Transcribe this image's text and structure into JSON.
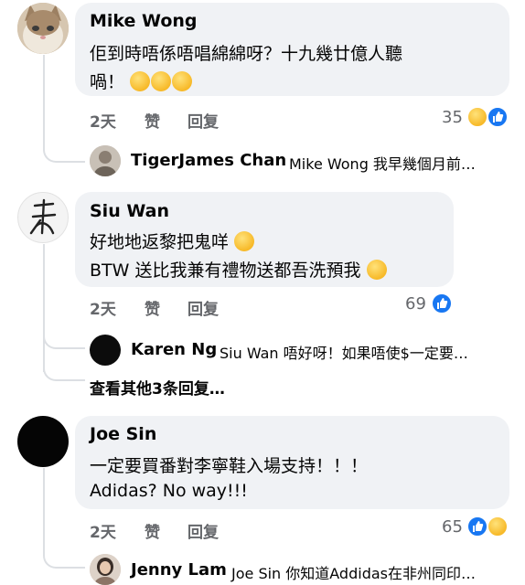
{
  "comments": [
    {
      "author": "Mike Wong",
      "lines": [
        "佢到時唔係唔唱綿綿呀？十九幾廿億人聽",
        "喎！"
      ],
      "time": "2天",
      "like_label": "赞",
      "reply_label": "回复",
      "reaction_count": "35",
      "reply": {
        "name": "TigerJames Chan",
        "text": "Mike Wong 我早幾個月前…"
      }
    },
    {
      "author": "Siu Wan",
      "lines": [
        "好地地返黎把鬼咩",
        "BTW 送比我兼有禮物送都吾洗預我"
      ],
      "time": "2天",
      "like_label": "赞",
      "reply_label": "回复",
      "reaction_count": "69",
      "reply": {
        "name": "Karen Ng",
        "text": "Siu Wan 唔好呀！如果唔使$一定要…"
      },
      "more_replies": "查看其他3条回复…"
    },
    {
      "author": "Joe Sin",
      "lines": [
        "一定要買番對李寧鞋入場支持！！！",
        "Adidas?  No way!!!"
      ],
      "time": "2天",
      "like_label": "赞",
      "reply_label": "回复",
      "reaction_count": "65",
      "reply": {
        "name": "Jenny Lam",
        "text": "Joe Sin 你知道Addidas在非州同印…"
      }
    }
  ],
  "icons": [
    "cat-avatar",
    "ink-brush-avatar",
    "black-avatar",
    "crying-laughing-emoji",
    "rolling-eyes-emoji",
    "yawning-emoji",
    "like-reaction-icon",
    "haha-reaction-icon"
  ],
  "colors": {
    "bubble": "#f0f2f5",
    "meta": "#65676b",
    "like": "#1877f2"
  }
}
